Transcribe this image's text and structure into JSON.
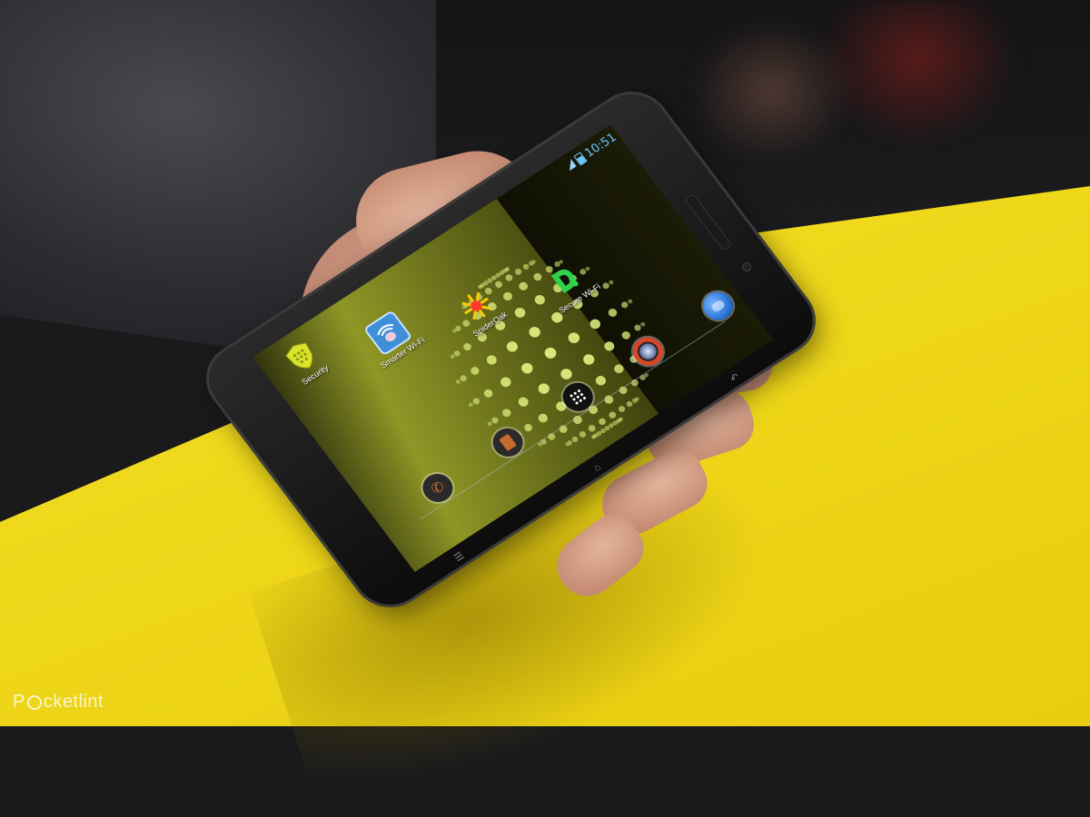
{
  "status_bar": {
    "time": "10:51"
  },
  "home_screen": {
    "apps": [
      {
        "label": "Security",
        "icon": "shield-icon",
        "color": "#d9e32a"
      },
      {
        "label": "Smarter Wi-Fi",
        "icon": "brain-wifi-icon",
        "color": "#3f8fd8"
      },
      {
        "label": "SpiderOak",
        "icon": "spiderwheel-icon",
        "color": "#ff3b30"
      },
      {
        "label": "Secure Wi-Fi",
        "icon": "disconnect-wifi-icon",
        "color": "#2fd24a"
      }
    ],
    "dock": [
      {
        "icon": "phone-icon",
        "color": "#c86a2e"
      },
      {
        "icon": "messages-icon",
        "color": "#c86a2e"
      },
      {
        "icon": "app-drawer-icon",
        "color": "#ffffff"
      },
      {
        "icon": "camera-icon",
        "color": "#d8462a"
      },
      {
        "icon": "globe-browser-icon",
        "color": "#2b74d8"
      }
    ],
    "wallpaper": {
      "icon": "dotted-globe-logo",
      "color": "#d8e87a"
    }
  },
  "navigation": {
    "keys": [
      {
        "icon": "recent-apps-icon"
      },
      {
        "icon": "home-icon"
      },
      {
        "icon": "back-icon"
      }
    ]
  },
  "watermark": {
    "text_before": "P",
    "text_after": "cketlint"
  }
}
